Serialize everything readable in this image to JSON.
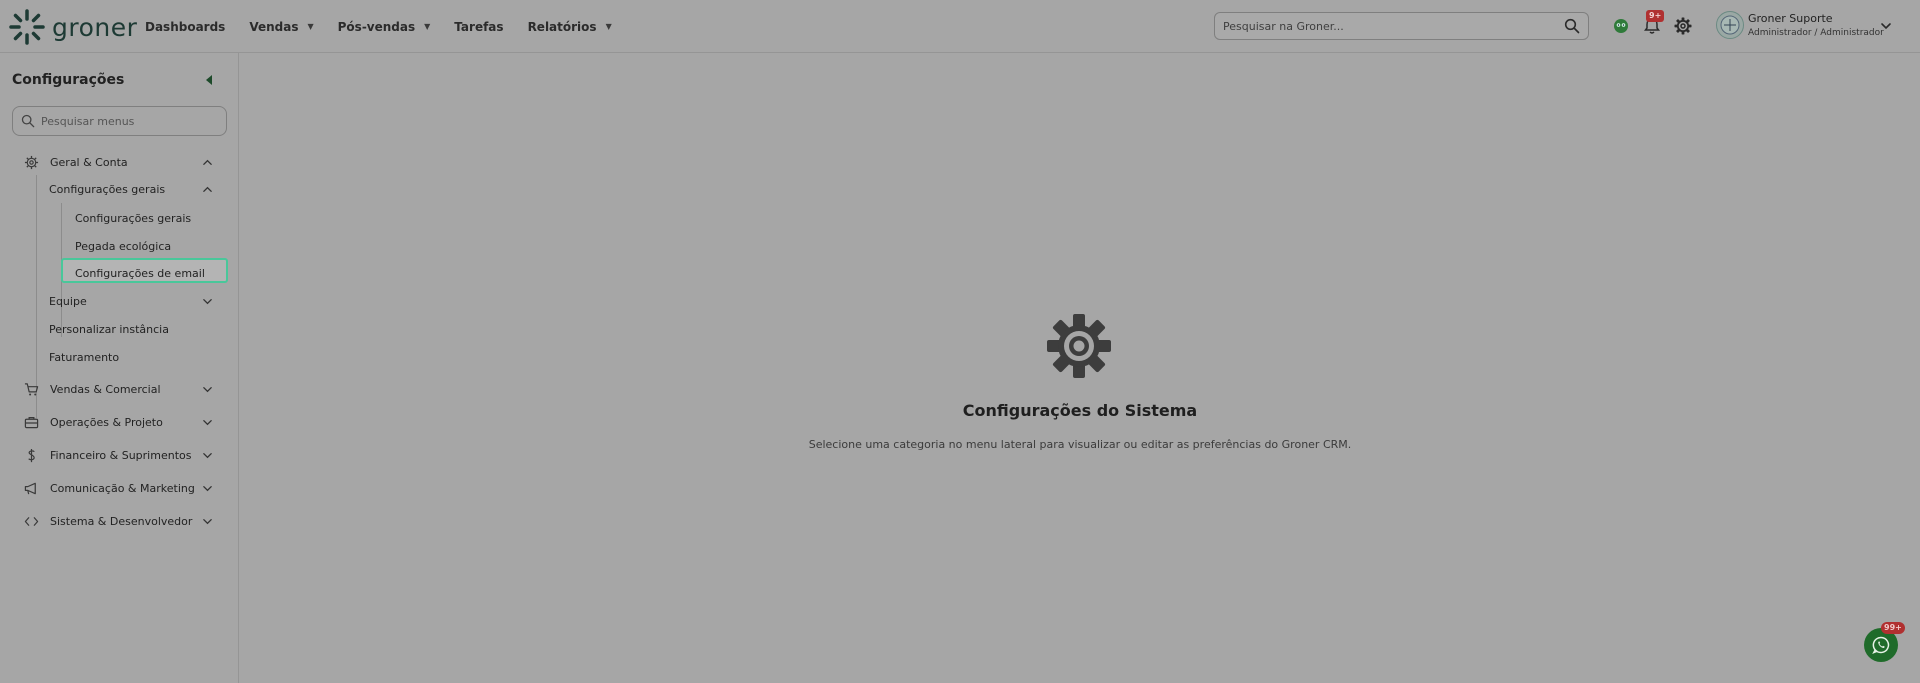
{
  "brand": {
    "name": "groner"
  },
  "nav": {
    "items": [
      {
        "label": "Dashboards",
        "has_caret": false
      },
      {
        "label": "Vendas",
        "has_caret": true
      },
      {
        "label": "Pós-vendas",
        "has_caret": true
      },
      {
        "label": "Tarefas",
        "has_caret": false
      },
      {
        "label": "Relatórios",
        "has_caret": true
      }
    ]
  },
  "search": {
    "placeholder": "Pesquisar na Groner..."
  },
  "notifications": {
    "badge": "9+"
  },
  "user": {
    "name": "Groner Suporte",
    "role": "Administrador / Administrador"
  },
  "sidebar": {
    "title": "Configurações",
    "search_placeholder": "Pesquisar menus",
    "sections": [
      {
        "label": "Geral & Conta",
        "icon": "gear-icon",
        "expanded": true
      },
      {
        "label": "Vendas & Comercial",
        "icon": "cart-icon",
        "expanded": false
      },
      {
        "label": "Operações & Projeto",
        "icon": "briefcase-icon",
        "expanded": false
      },
      {
        "label": "Financeiro & Suprimentos",
        "icon": "dollar-icon",
        "expanded": false
      },
      {
        "label": "Comunicação & Marketing",
        "icon": "megaphone-icon",
        "expanded": false
      },
      {
        "label": "Sistema & Desenvolvedor",
        "icon": "code-icon",
        "expanded": false
      }
    ],
    "geral_children": [
      {
        "label": "Configurações gerais",
        "expanded": true
      },
      {
        "label": "Equipe",
        "expanded": false
      },
      {
        "label": "Personalizar instância"
      },
      {
        "label": "Faturamento"
      }
    ],
    "config_gerais_children": [
      {
        "label": "Configurações gerais",
        "active": true
      },
      {
        "label": "Pegada ecológica"
      },
      {
        "label": "Configurações de email"
      }
    ]
  },
  "main": {
    "title": "Configurações do Sistema",
    "subtitle": "Selecione uma categoria no menu lateral para visualizar ou editar as preferências do Groner CRM."
  },
  "whatsapp": {
    "badge": "99+"
  },
  "colors": {
    "accent": "#49c79a",
    "brand": "#1d3a34",
    "badge": "#b03030"
  }
}
